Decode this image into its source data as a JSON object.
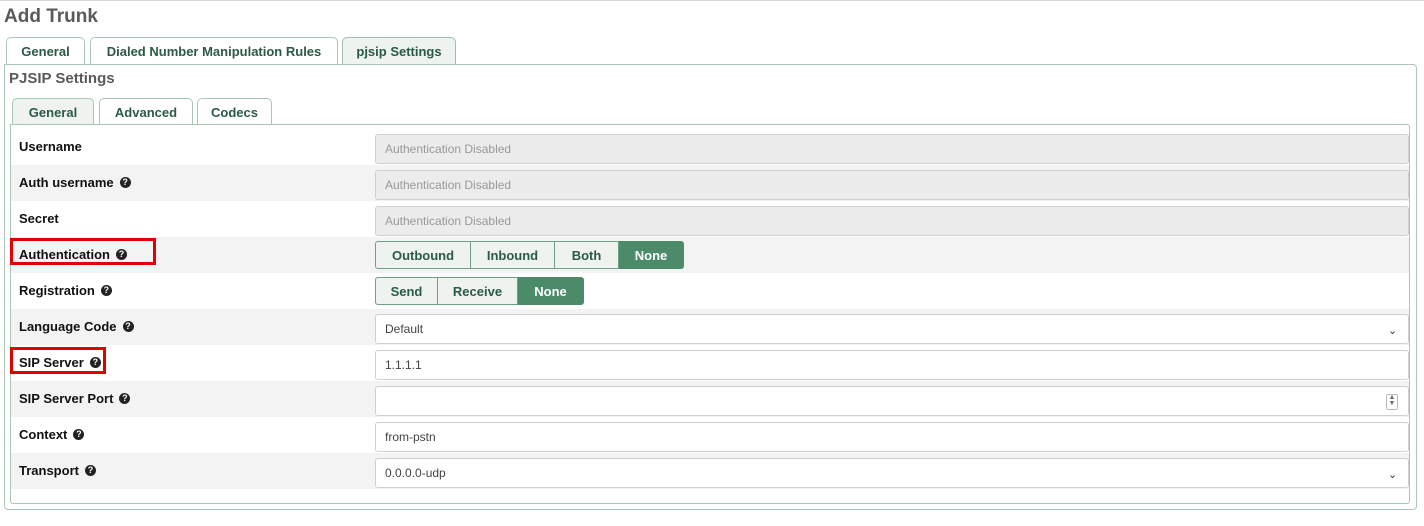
{
  "page": {
    "title": "Add Trunk"
  },
  "outer_tabs": [
    {
      "label": "General",
      "active": false
    },
    {
      "label": "Dialed Number Manipulation Rules",
      "active": false
    },
    {
      "label": "pjsip Settings",
      "active": true
    }
  ],
  "section": {
    "title": "PJSIP Settings"
  },
  "inner_tabs": [
    {
      "label": "General",
      "active": true
    },
    {
      "label": "Advanced",
      "active": false
    },
    {
      "label": "Codecs",
      "active": false
    }
  ],
  "form": {
    "username": {
      "label": "Username",
      "value": "Authentication Disabled"
    },
    "auth_username": {
      "label": "Auth username",
      "value": "Authentication Disabled"
    },
    "secret": {
      "label": "Secret",
      "value": "Authentication Disabled"
    },
    "authentication": {
      "label": "Authentication",
      "options": [
        "Outbound",
        "Inbound",
        "Both",
        "None"
      ],
      "selected": "None"
    },
    "registration": {
      "label": "Registration",
      "options": [
        "Send",
        "Receive",
        "None"
      ],
      "selected": "None"
    },
    "language_code": {
      "label": "Language Code",
      "value": "Default"
    },
    "sip_server": {
      "label": "SIP Server",
      "value": "1.1.1.1"
    },
    "sip_server_port": {
      "label": "SIP Server Port",
      "value": ""
    },
    "context": {
      "label": "Context",
      "value": "from-pstn"
    },
    "transport": {
      "label": "Transport",
      "value": "0.0.0.0-udp"
    }
  },
  "icons": {
    "help": "question-circle-icon",
    "dropdown": "chevron-down-icon",
    "spinner": "spinner-arrows-icon"
  },
  "colors": {
    "accent": "#4b8b6a",
    "tab_text": "#2b5a45",
    "highlight": "#e00000"
  }
}
